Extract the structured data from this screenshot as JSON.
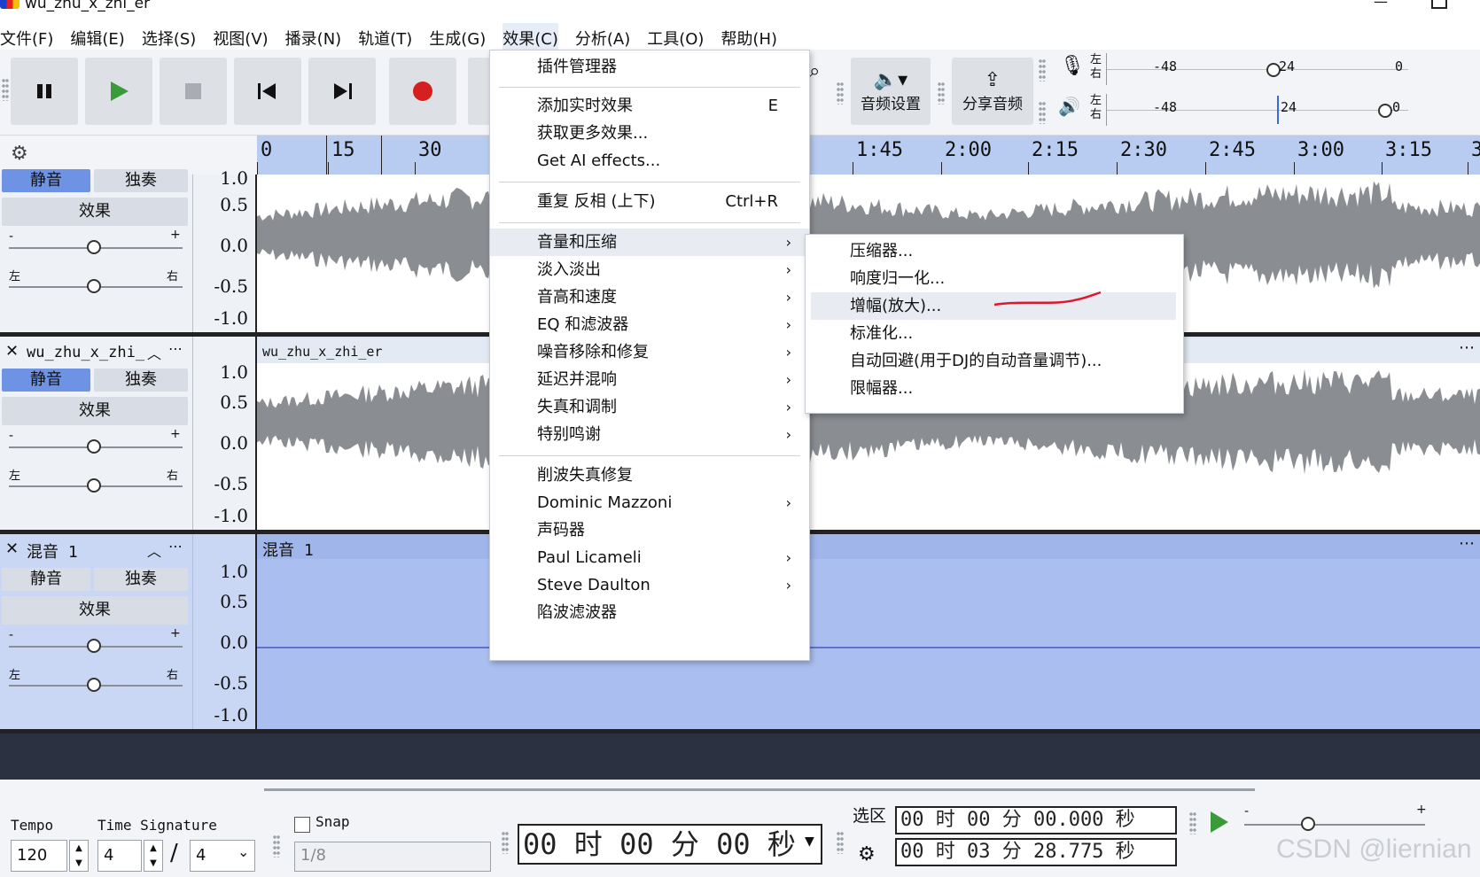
{
  "window": {
    "title": "wu_zhu_x_zhi_er"
  },
  "menubar": [
    "文件(F)",
    "编辑(E)",
    "选择(S)",
    "视图(V)",
    "播录(N)",
    "轨道(T)",
    "生成(G)",
    "效果(C)",
    "分析(A)",
    "工具(O)",
    "帮助(H)"
  ],
  "toolbar": {
    "audio_setup": "音频设置",
    "share_audio": "分享音频",
    "meter_lr_top": "左",
    "meter_lr_bottom": "右",
    "meter_rec_ticks": [
      "-48",
      "24",
      "0"
    ],
    "meter_play_ticks": [
      "-48",
      "24",
      "0"
    ]
  },
  "ruler": {
    "ticks": [
      "0",
      "15",
      "30",
      "1:45",
      "2:00",
      "2:15",
      "2:30",
      "2:45",
      "3:00",
      "3:15",
      "3"
    ]
  },
  "track_buttons": {
    "mute": "静音",
    "solo": "独奏",
    "effects": "效果",
    "left": "左",
    "right": "右",
    "minus": "-",
    "plus": "+"
  },
  "scale": [
    "1.0",
    "0.5",
    "0.0",
    "-0.5",
    "-1.0"
  ],
  "tracks": [
    {
      "name": "wu_zhu_x_zhi_",
      "clip": "wu_zhu_x_zhi_er"
    },
    {
      "name": "混音 1",
      "clip": "混音 1"
    }
  ],
  "effects_menu": {
    "items": [
      {
        "label": "插件管理器",
        "accel": "",
        "sub": false
      },
      {
        "label": "添加实时效果",
        "accel": "E",
        "sub": false
      },
      {
        "label": "获取更多效果...",
        "accel": "",
        "sub": false
      },
      {
        "label": "Get AI effects...",
        "accel": "",
        "sub": false
      },
      {
        "label": "重复 反相 (上下)",
        "accel": "Ctrl+R",
        "sub": false
      },
      {
        "label": "音量和压缩",
        "accel": "",
        "sub": true
      },
      {
        "label": "淡入淡出",
        "accel": "",
        "sub": true
      },
      {
        "label": "音高和速度",
        "accel": "",
        "sub": true
      },
      {
        "label": "EQ 和滤波器",
        "accel": "",
        "sub": true
      },
      {
        "label": "噪音移除和修复",
        "accel": "",
        "sub": true
      },
      {
        "label": "延迟并混响",
        "accel": "",
        "sub": true
      },
      {
        "label": "失真和调制",
        "accel": "",
        "sub": true
      },
      {
        "label": "特别鸣谢",
        "accel": "",
        "sub": true
      },
      {
        "label": "削波失真修复",
        "accel": "",
        "sub": false
      },
      {
        "label": "Dominic Mazzoni",
        "accel": "",
        "sub": true
      },
      {
        "label": "声码器",
        "accel": "",
        "sub": false
      },
      {
        "label": "Paul Licameli",
        "accel": "",
        "sub": true
      },
      {
        "label": "Steve Daulton",
        "accel": "",
        "sub": true
      },
      {
        "label": "陷波滤波器",
        "accel": "",
        "sub": false
      }
    ]
  },
  "submenu": {
    "items": [
      "压缩器...",
      "响度归一化...",
      "增幅(放大)...",
      "标准化...",
      "自动回避(用于DJ的自动音量调节)...",
      "限幅器..."
    ]
  },
  "bottom": {
    "tempo_label": "Tempo",
    "tempo_value": "120",
    "timesig_label": "Time Signature",
    "timesig_num": "4",
    "timesig_den": "4",
    "snap_label": "Snap",
    "snap_value": "1/8",
    "time_main": "00 时 00 分 00 秒",
    "selection_label": "选区",
    "sel_start": "00 时 00 分 00.000 秒",
    "sel_end": "00 时 03 分 28.775 秒"
  },
  "watermark": "CSDN @liernian"
}
